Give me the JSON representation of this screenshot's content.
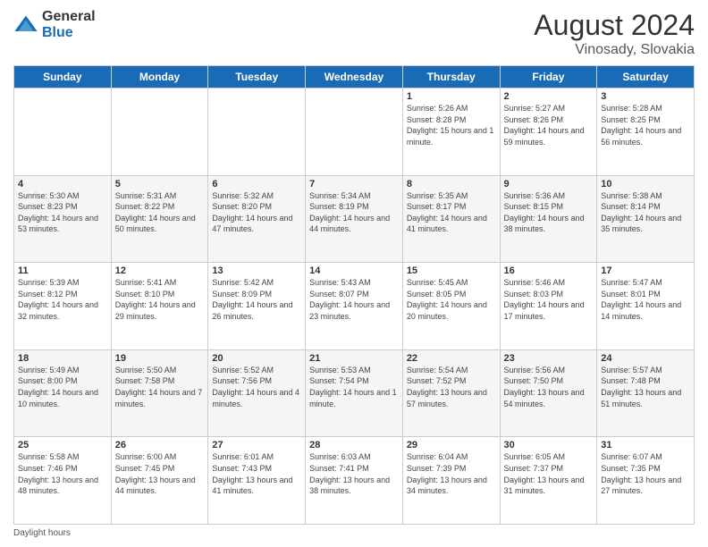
{
  "logo": {
    "general": "General",
    "blue": "Blue"
  },
  "title": {
    "month_year": "August 2024",
    "location": "Vinosady, Slovakia"
  },
  "days_of_week": [
    "Sunday",
    "Monday",
    "Tuesday",
    "Wednesday",
    "Thursday",
    "Friday",
    "Saturday"
  ],
  "footer": {
    "daylight_label": "Daylight hours"
  },
  "weeks": [
    [
      {
        "day": "",
        "info": ""
      },
      {
        "day": "",
        "info": ""
      },
      {
        "day": "",
        "info": ""
      },
      {
        "day": "",
        "info": ""
      },
      {
        "day": "1",
        "info": "Sunrise: 5:26 AM\nSunset: 8:28 PM\nDaylight: 15 hours\nand 1 minute."
      },
      {
        "day": "2",
        "info": "Sunrise: 5:27 AM\nSunset: 8:26 PM\nDaylight: 14 hours\nand 59 minutes."
      },
      {
        "day": "3",
        "info": "Sunrise: 5:28 AM\nSunset: 8:25 PM\nDaylight: 14 hours\nand 56 minutes."
      }
    ],
    [
      {
        "day": "4",
        "info": "Sunrise: 5:30 AM\nSunset: 8:23 PM\nDaylight: 14 hours\nand 53 minutes."
      },
      {
        "day": "5",
        "info": "Sunrise: 5:31 AM\nSunset: 8:22 PM\nDaylight: 14 hours\nand 50 minutes."
      },
      {
        "day": "6",
        "info": "Sunrise: 5:32 AM\nSunset: 8:20 PM\nDaylight: 14 hours\nand 47 minutes."
      },
      {
        "day": "7",
        "info": "Sunrise: 5:34 AM\nSunset: 8:19 PM\nDaylight: 14 hours\nand 44 minutes."
      },
      {
        "day": "8",
        "info": "Sunrise: 5:35 AM\nSunset: 8:17 PM\nDaylight: 14 hours\nand 41 minutes."
      },
      {
        "day": "9",
        "info": "Sunrise: 5:36 AM\nSunset: 8:15 PM\nDaylight: 14 hours\nand 38 minutes."
      },
      {
        "day": "10",
        "info": "Sunrise: 5:38 AM\nSunset: 8:14 PM\nDaylight: 14 hours\nand 35 minutes."
      }
    ],
    [
      {
        "day": "11",
        "info": "Sunrise: 5:39 AM\nSunset: 8:12 PM\nDaylight: 14 hours\nand 32 minutes."
      },
      {
        "day": "12",
        "info": "Sunrise: 5:41 AM\nSunset: 8:10 PM\nDaylight: 14 hours\nand 29 minutes."
      },
      {
        "day": "13",
        "info": "Sunrise: 5:42 AM\nSunset: 8:09 PM\nDaylight: 14 hours\nand 26 minutes."
      },
      {
        "day": "14",
        "info": "Sunrise: 5:43 AM\nSunset: 8:07 PM\nDaylight: 14 hours\nand 23 minutes."
      },
      {
        "day": "15",
        "info": "Sunrise: 5:45 AM\nSunset: 8:05 PM\nDaylight: 14 hours\nand 20 minutes."
      },
      {
        "day": "16",
        "info": "Sunrise: 5:46 AM\nSunset: 8:03 PM\nDaylight: 14 hours\nand 17 minutes."
      },
      {
        "day": "17",
        "info": "Sunrise: 5:47 AM\nSunset: 8:01 PM\nDaylight: 14 hours\nand 14 minutes."
      }
    ],
    [
      {
        "day": "18",
        "info": "Sunrise: 5:49 AM\nSunset: 8:00 PM\nDaylight: 14 hours\nand 10 minutes."
      },
      {
        "day": "19",
        "info": "Sunrise: 5:50 AM\nSunset: 7:58 PM\nDaylight: 14 hours\nand 7 minutes."
      },
      {
        "day": "20",
        "info": "Sunrise: 5:52 AM\nSunset: 7:56 PM\nDaylight: 14 hours\nand 4 minutes."
      },
      {
        "day": "21",
        "info": "Sunrise: 5:53 AM\nSunset: 7:54 PM\nDaylight: 14 hours\nand 1 minute."
      },
      {
        "day": "22",
        "info": "Sunrise: 5:54 AM\nSunset: 7:52 PM\nDaylight: 13 hours\nand 57 minutes."
      },
      {
        "day": "23",
        "info": "Sunrise: 5:56 AM\nSunset: 7:50 PM\nDaylight: 13 hours\nand 54 minutes."
      },
      {
        "day": "24",
        "info": "Sunrise: 5:57 AM\nSunset: 7:48 PM\nDaylight: 13 hours\nand 51 minutes."
      }
    ],
    [
      {
        "day": "25",
        "info": "Sunrise: 5:58 AM\nSunset: 7:46 PM\nDaylight: 13 hours\nand 48 minutes."
      },
      {
        "day": "26",
        "info": "Sunrise: 6:00 AM\nSunset: 7:45 PM\nDaylight: 13 hours\nand 44 minutes."
      },
      {
        "day": "27",
        "info": "Sunrise: 6:01 AM\nSunset: 7:43 PM\nDaylight: 13 hours\nand 41 minutes."
      },
      {
        "day": "28",
        "info": "Sunrise: 6:03 AM\nSunset: 7:41 PM\nDaylight: 13 hours\nand 38 minutes."
      },
      {
        "day": "29",
        "info": "Sunrise: 6:04 AM\nSunset: 7:39 PM\nDaylight: 13 hours\nand 34 minutes."
      },
      {
        "day": "30",
        "info": "Sunrise: 6:05 AM\nSunset: 7:37 PM\nDaylight: 13 hours\nand 31 minutes."
      },
      {
        "day": "31",
        "info": "Sunrise: 6:07 AM\nSunset: 7:35 PM\nDaylight: 13 hours\nand 27 minutes."
      }
    ]
  ]
}
